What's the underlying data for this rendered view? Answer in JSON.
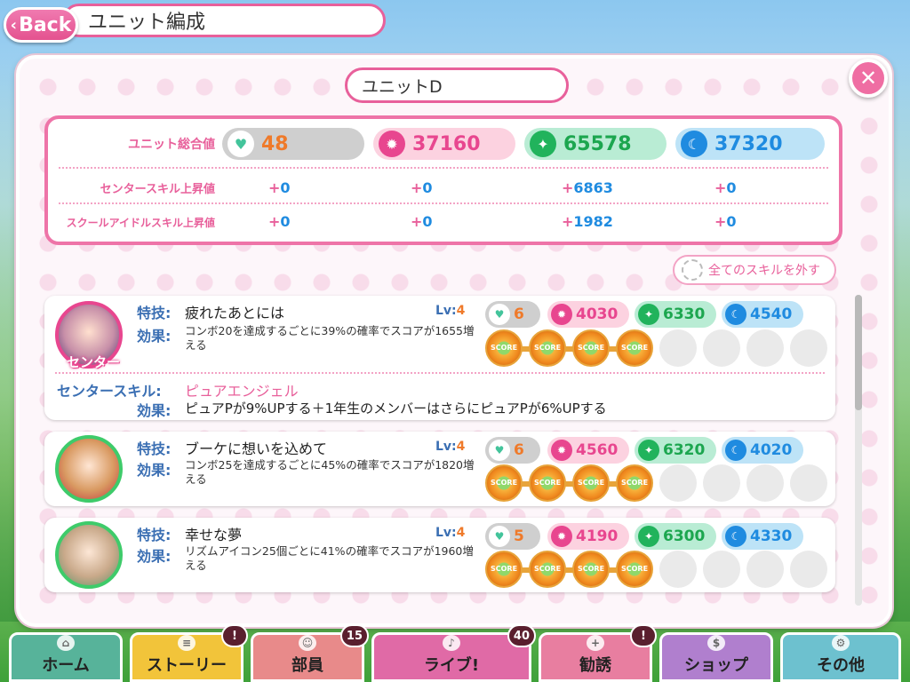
{
  "header": {
    "back_label": "Back",
    "title": "ユニット編成"
  },
  "unit": {
    "name": "ユニットD",
    "remove_skills_label": "全てのスキルを外す"
  },
  "summary": {
    "row_labels": {
      "total": "ユニット総合値",
      "center": "センタースキル上昇値",
      "school": "スクールアイドルスキル上昇値"
    },
    "totals": {
      "heart": "48",
      "smile": "37160",
      "pure": "65578",
      "cool": "37320"
    },
    "center_bonus": {
      "heart": "0",
      "smile": "0",
      "pure": "6863",
      "cool": "0"
    },
    "school_bonus": {
      "heart": "0",
      "smile": "0",
      "pure": "1982",
      "cool": "0"
    }
  },
  "labels": {
    "skill": "特技:",
    "effect": "効果:",
    "center_skill": "センタースキル:",
    "lv": "Lv:",
    "center_tag": "センター",
    "gem_text": "SCORE"
  },
  "members": [
    {
      "skill_name": "疲れたあとには",
      "lv": "4",
      "effect": "コンボ20を達成するごとに39%の確率でスコアが1655増える",
      "heart": "6",
      "smile": "4030",
      "pure": "6330",
      "cool": "4540",
      "center_skill_name": "ピュアエンジェル",
      "center_skill_effect": "ピュアPが9%UPする＋1年生のメンバーはさらにピュアPが6%UPする"
    },
    {
      "skill_name": "ブーケに想いを込めて",
      "lv": "4",
      "effect": "コンボ25を達成するごとに45%の確率でスコアが1820増える",
      "heart": "6",
      "smile": "4560",
      "pure": "6320",
      "cool": "4020"
    },
    {
      "skill_name": "幸せな夢",
      "lv": "4",
      "effect": "リズムアイコン25個ごとに41%の確率でスコアが1960増える",
      "heart": "5",
      "smile": "4190",
      "pure": "6300",
      "cool": "4330"
    }
  ],
  "nav": [
    {
      "label": "ホーム",
      "color": "#57b39a"
    },
    {
      "label": "ストーリー",
      "color": "#f2c43a",
      "badge": ""
    },
    {
      "label": "部員",
      "color": "#e88a8a",
      "badge": "15"
    },
    {
      "label": "ライブ!",
      "color": "#e06aa6",
      "badge": "40"
    },
    {
      "label": "勧誘",
      "color": "#e87ea0",
      "badge": ""
    },
    {
      "label": "ショップ",
      "color": "#b07fce"
    },
    {
      "label": "その他",
      "color": "#6dc1cf"
    }
  ]
}
